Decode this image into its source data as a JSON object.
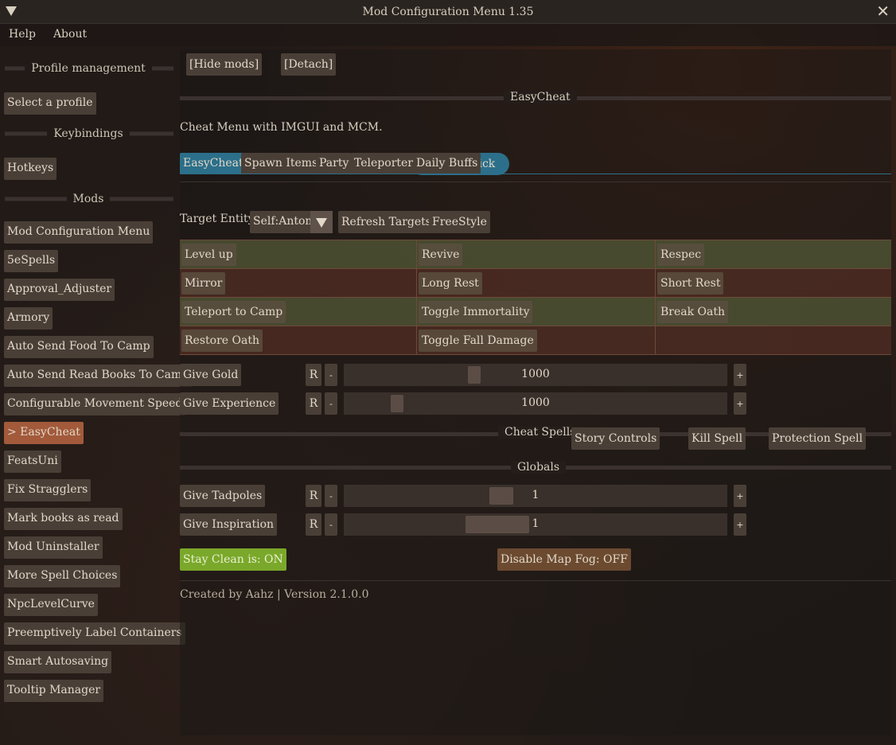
{
  "window": {
    "title": "Mod Configuration Menu 1.35"
  },
  "menubar": {
    "items": [
      "Help",
      "About"
    ]
  },
  "sidebar": {
    "profile_header": "Profile management",
    "select_profile": "Select a profile",
    "keybindings_header": "Keybindings",
    "hotkeys": "Hotkeys",
    "mods_header": "Mods",
    "mods": [
      "Mod Configuration Menu",
      "5eSpells",
      "Approval_Adjuster",
      "Armory",
      "Auto Send Food To Camp",
      "Auto Send Read Books To Camp",
      "Configurable Movement Speed",
      "> EasyCheat",
      "FeatsUni",
      "Fix Stragglers",
      "Mark books as read",
      "Mod Uninstaller",
      "More Spell Choices",
      "NpcLevelCurve",
      "Preemptively Label Containers",
      "Smart Autosaving",
      "Tooltip Manager"
    ],
    "active_index": 7
  },
  "main": {
    "hide_mods": "[Hide mods]",
    "detach": "[Detach]",
    "section_title": "EasyCheat",
    "description": "Cheat Menu with IMGUI and MCM.",
    "tabs": [
      "EasyCheat",
      "Spawn Items",
      "Party",
      "Teleporter",
      "Daily Buffs"
    ],
    "tab_overflow_fragments": [
      "s",
      "t",
      "kick"
    ],
    "target_label": "Target Entity",
    "target_value": "Self:Anton",
    "refresh_targets": "Refresh Targets",
    "freestyle": "FreeStyle",
    "action_grid": [
      [
        "Level up",
        "Revive",
        "Respec"
      ],
      [
        "Mirror",
        "Long Rest",
        "Short Rest"
      ],
      [
        "Teleport to Camp",
        "Toggle Immortality",
        "Break Oath"
      ],
      [
        "Restore Oath",
        "Toggle Fall Damage",
        ""
      ]
    ],
    "sliders_top": [
      {
        "name": "Give Gold",
        "value": "1000",
        "fraction": 0.34
      },
      {
        "name": "Give Experience",
        "value": "1000",
        "fraction": 0.14
      }
    ],
    "reset_label": "R",
    "minus_label": "-",
    "plus_label": "+",
    "cheat_spells_label": "Cheat Spells",
    "spell_buttons": [
      "Story Controls",
      "Kill Spell",
      "Protection Spell"
    ],
    "globals_label": "Globals",
    "sliders_globals": [
      {
        "name": "Give Tadpoles",
        "value": "1",
        "fraction": 0.41
      },
      {
        "name": "Give Inspiration",
        "value": "1",
        "fraction": 0.4
      }
    ],
    "stay_clean": "Stay Clean is: ON",
    "disable_fog": "Disable Map Fog: OFF",
    "footer": "Created by Aahz | Version 2.1.0.0"
  },
  "colors": {
    "active_mod": "#a25a3b",
    "active_tab": "#2c6f8a",
    "toggle_on": "#7aa82a",
    "toggle_off": "#6b4a30",
    "grid_green": "#4e5232",
    "grid_red": "#4c2c22"
  }
}
